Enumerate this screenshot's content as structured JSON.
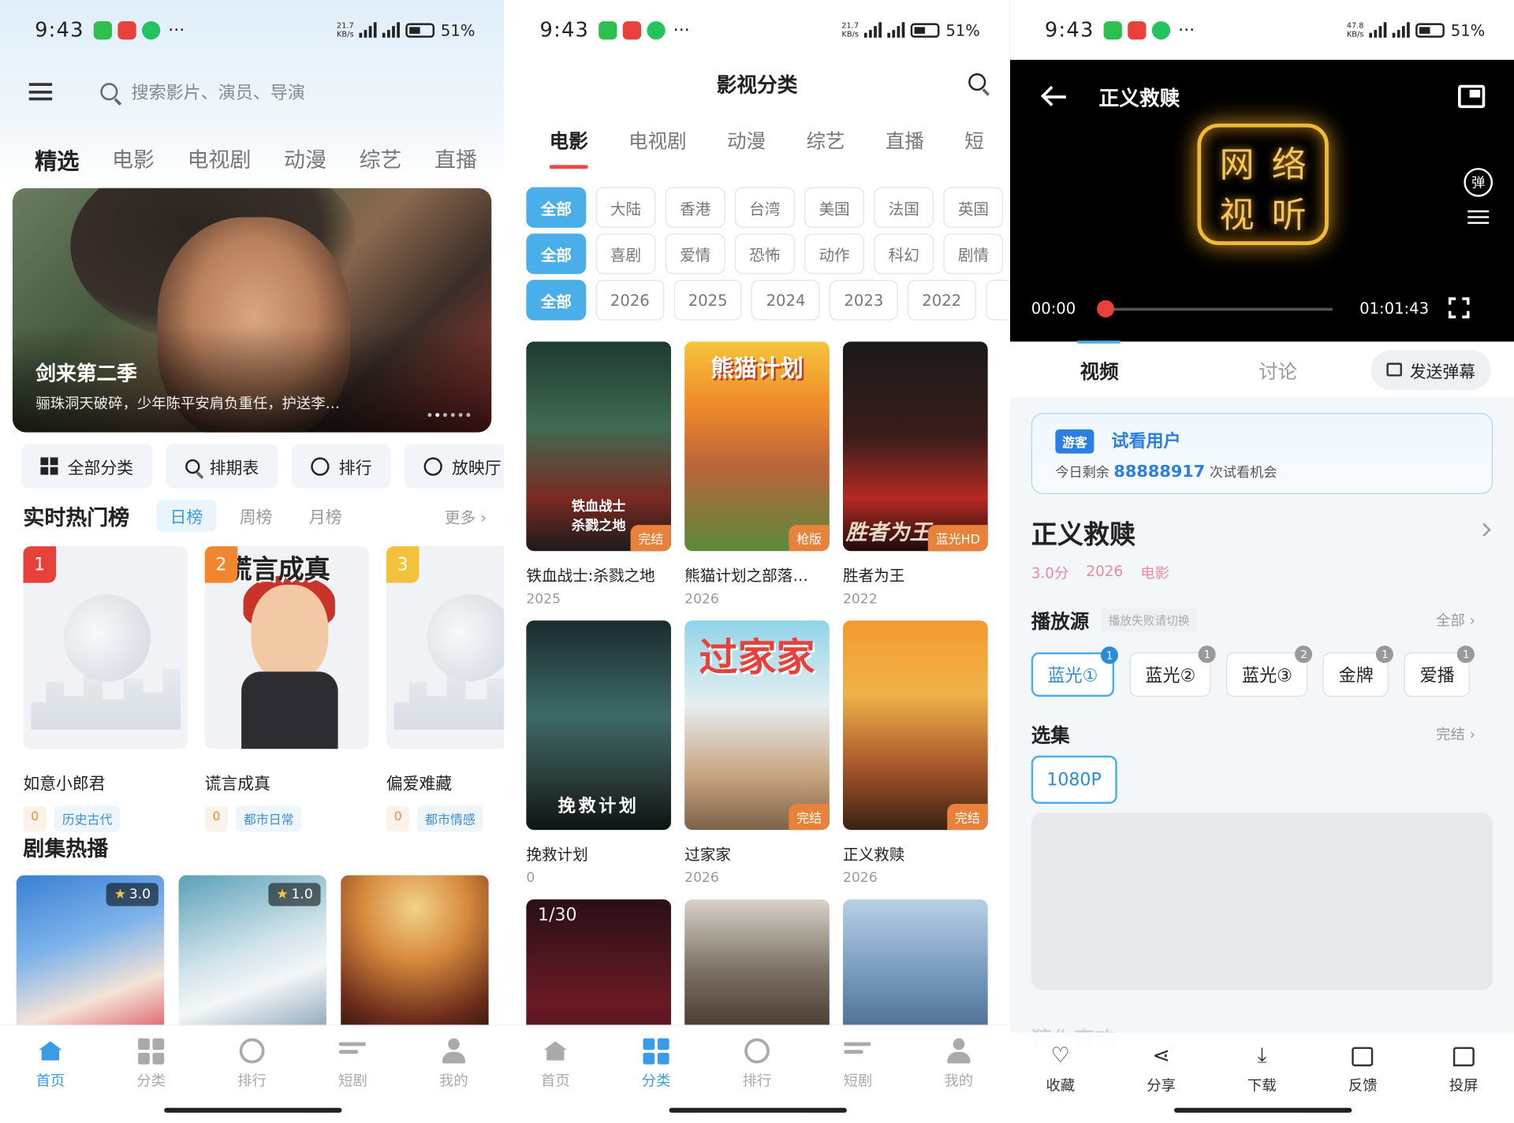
{
  "status": {
    "time": "9:43",
    "speed1": "21.7",
    "speed2": "47.8",
    "unit": "KB/s",
    "net": "5G",
    "battery": "51%"
  },
  "home": {
    "search_placeholder": "搜索影片、演员、导演",
    "tabs": [
      "精选",
      "电影",
      "电视剧",
      "动漫",
      "综艺",
      "直播"
    ],
    "banner": {
      "title": "剑来第二季",
      "subtitle": "骊珠洞天破碎，少年陈平安肩负重任，护送李…"
    },
    "quick": [
      "全部分类",
      "排期表",
      "排行",
      "放映厅"
    ],
    "hot": {
      "title": "实时热门榜",
      "segments": [
        "日榜",
        "周榜",
        "月榜"
      ],
      "more": "更多 ›",
      "items": [
        {
          "rank": "1",
          "name": "如意小郎君",
          "score": "0",
          "tag": "历史古代",
          "color": "#e8413a"
        },
        {
          "rank": "2",
          "name": "谎言成真",
          "score": "0",
          "tag": "都市日常",
          "color": "#f0862f",
          "poster_text": "谎言成真"
        },
        {
          "rank": "3",
          "name": "偏爱难藏",
          "score": "0",
          "tag": "都市情感",
          "color": "#f3c23a"
        }
      ]
    },
    "drama_title": "剧集热播",
    "dramas": [
      {
        "score": "3.0"
      },
      {
        "score": "1.0"
      },
      {
        "score": ""
      }
    ]
  },
  "nav": [
    "首页",
    "分类",
    "排行",
    "短剧",
    "我的"
  ],
  "category": {
    "title": "影视分类",
    "tabs": [
      "电影",
      "电视剧",
      "动漫",
      "综艺",
      "直播",
      "短"
    ],
    "regions": [
      "全部",
      "大陆",
      "香港",
      "台湾",
      "美国",
      "法国",
      "英国"
    ],
    "genres": [
      "全部",
      "喜剧",
      "爱情",
      "恐怖",
      "动作",
      "科幻",
      "剧情"
    ],
    "years": [
      "全部",
      "2026",
      "2025",
      "2024",
      "2023",
      "2022",
      "2"
    ],
    "movies": [
      {
        "title": "铁血战士:杀戮之地",
        "year": "2025",
        "badge": "完结",
        "poster_text": "铁血战士\n杀戮之地"
      },
      {
        "title": "熊猫计划之部落…",
        "year": "2026",
        "badge": "枪版",
        "poster_text": "熊猫计划"
      },
      {
        "title": "胜者为王",
        "year": "2022",
        "badge": "蓝光HD",
        "poster_text": "胜者为王"
      },
      {
        "title": "挽救计划",
        "year": "0",
        "badge": "",
        "poster_text": "挽救计划"
      },
      {
        "title": "过家家",
        "year": "2026",
        "badge": "完结",
        "poster_text": "过家家"
      },
      {
        "title": "正义救赎",
        "year": "2026",
        "badge": "完结",
        "poster_text": ""
      },
      {
        "title": "",
        "year": "",
        "badge": "",
        "poster_text": "1/30"
      },
      {
        "title": "",
        "year": "",
        "badge": "",
        "poster_text": ""
      },
      {
        "title": "",
        "year": "",
        "badge": "",
        "poster_text": ""
      }
    ]
  },
  "detail": {
    "title": "正义救赎",
    "logo_chars": [
      "网",
      "络",
      "视",
      "听"
    ],
    "danmaku_label": "弹",
    "time_current": "00:00",
    "time_total": "01:01:43",
    "progress": 0,
    "tabs": [
      "视频",
      "讨论"
    ],
    "send_danmaku": "发送弹幕",
    "guest": {
      "tag": "游客",
      "name": "试看用户",
      "prefix": "今日剩余",
      "count": "88888917",
      "suffix": "次试看机会"
    },
    "meta": {
      "score": "3.0分",
      "year": "2026",
      "type": "电影"
    },
    "source": {
      "title": "播放源",
      "hint": "播放失败请切换",
      "more": "全部 ›"
    },
    "sources": [
      {
        "label": "蓝光①",
        "n": "1"
      },
      {
        "label": "蓝光②",
        "n": "1"
      },
      {
        "label": "蓝光③",
        "n": "2"
      },
      {
        "label": "金牌",
        "n": "1"
      },
      {
        "label": "爱播",
        "n": "1"
      }
    ],
    "episodes": {
      "title": "选集",
      "status": "完结 ›",
      "items": [
        "1080P"
      ]
    },
    "faded_title": "猜你喜欢",
    "actions": [
      "收藏",
      "分享",
      "下载",
      "反馈",
      "投屏"
    ]
  }
}
